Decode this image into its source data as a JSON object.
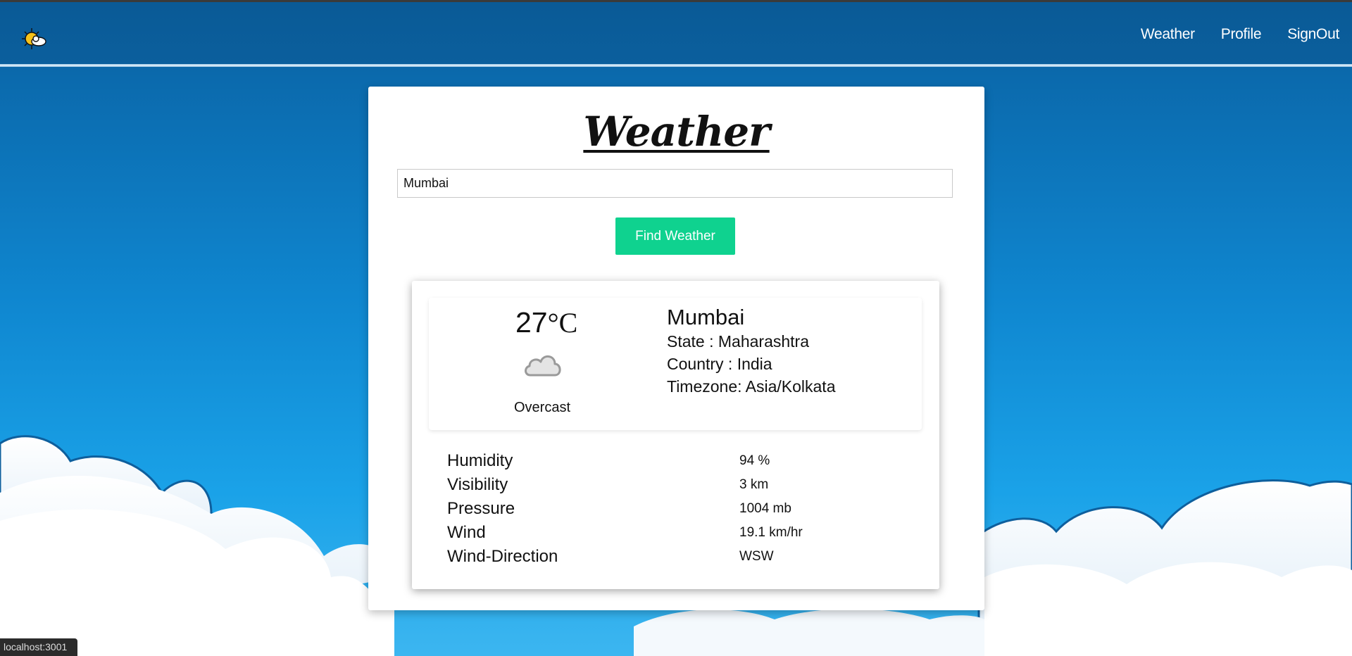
{
  "nav": {
    "logo_icon": "sun-cloud-icon",
    "links": [
      "Weather",
      "Profile",
      "SignOut"
    ]
  },
  "main": {
    "title": "Weather",
    "search": {
      "value": "Mumbai"
    },
    "find_button": "Find Weather"
  },
  "result": {
    "temperature": "27",
    "unit": "°C",
    "condition_icon": "cloud-icon",
    "condition": "Overcast",
    "city": "Mumbai",
    "state": "State : Maharashtra",
    "country": "Country : India",
    "timezone": "Timezone: Asia/Kolkata",
    "stats": [
      {
        "label": "Humidity",
        "value": "94 %"
      },
      {
        "label": "Visibility",
        "value": "3 km"
      },
      {
        "label": "Pressure",
        "value": "1004 mb"
      },
      {
        "label": "Wind",
        "value": "19.1 km/hr"
      },
      {
        "label": "Wind-Direction",
        "value": "WSW"
      }
    ]
  },
  "status": {
    "url": "localhost:3001"
  },
  "colors": {
    "accent_button": "#0fd28f",
    "nav_bg": "#0b5f9d"
  }
}
